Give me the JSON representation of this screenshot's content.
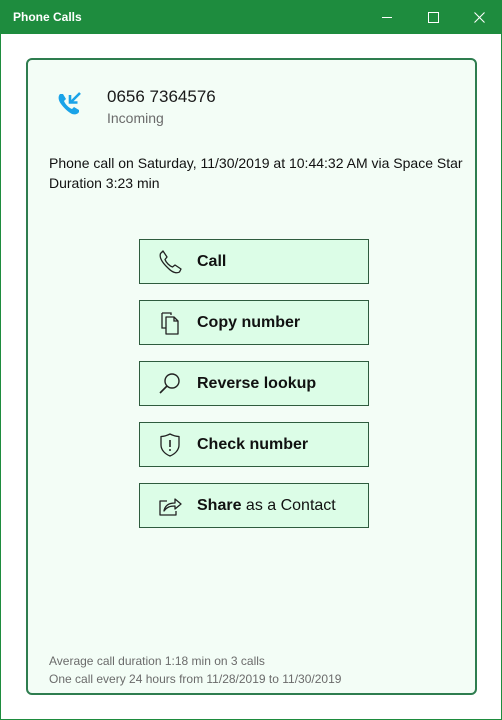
{
  "window": {
    "title": "Phone Calls",
    "accent_color": "#1e8c3e"
  },
  "call": {
    "number": "0656 7364576",
    "type": "Incoming",
    "icon": "incoming-call-icon",
    "details_line1": "Phone call on Saturday, 11/30/2019 at 10:44:32 AM via Space Star",
    "details_line2": "Duration 3:23 min"
  },
  "actions": {
    "call_label": "Call",
    "copy_label": "Copy number",
    "lookup_label": "Reverse lookup",
    "check_label": "Check number",
    "share_label_bold": "Share",
    "share_label_rest": " as a Contact"
  },
  "stats": {
    "average": "Average call duration 1:18 min on 3 calls",
    "frequency": "One call every 24 hours from 11/28/2019 to 11/30/2019"
  }
}
